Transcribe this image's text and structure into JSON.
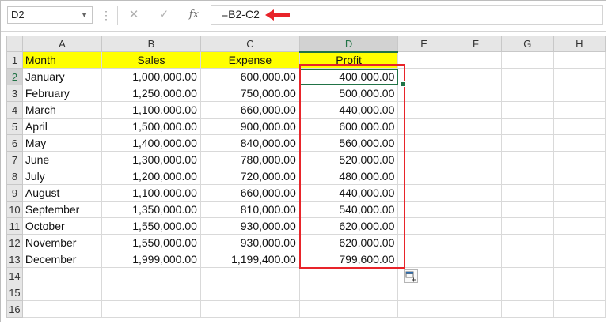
{
  "formula_bar": {
    "name_box": "D2",
    "name_box_arrow": "▼",
    "dots": "⋮",
    "cancel_icon": "✕",
    "enter_icon": "✓",
    "fx_label": "fx",
    "formula": "=B2-C2",
    "arrow_color": "#e8242a"
  },
  "columns": [
    "A",
    "B",
    "C",
    "D",
    "E",
    "F",
    "G",
    "H"
  ],
  "selected_column": "D",
  "selected_cell": "D2",
  "highlight_color": "#e8242a",
  "header_fill_color": "#ffff00",
  "rows": [
    {
      "num": "1",
      "cells": [
        "Month",
        "Sales",
        "Expense",
        "Profit",
        "",
        "",
        "",
        ""
      ]
    },
    {
      "num": "2",
      "cells": [
        "January",
        "1,000,000.00",
        "600,000.00",
        "400,000.00",
        "",
        "",
        "",
        ""
      ]
    },
    {
      "num": "3",
      "cells": [
        "February",
        "1,250,000.00",
        "750,000.00",
        "500,000.00",
        "",
        "",
        "",
        ""
      ]
    },
    {
      "num": "4",
      "cells": [
        "March",
        "1,100,000.00",
        "660,000.00",
        "440,000.00",
        "",
        "",
        "",
        ""
      ]
    },
    {
      "num": "5",
      "cells": [
        "April",
        "1,500,000.00",
        "900,000.00",
        "600,000.00",
        "",
        "",
        "",
        ""
      ]
    },
    {
      "num": "6",
      "cells": [
        "May",
        "1,400,000.00",
        "840,000.00",
        "560,000.00",
        "",
        "",
        "",
        ""
      ]
    },
    {
      "num": "7",
      "cells": [
        "June",
        "1,300,000.00",
        "780,000.00",
        "520,000.00",
        "",
        "",
        "",
        ""
      ]
    },
    {
      "num": "8",
      "cells": [
        "July",
        "1,200,000.00",
        "720,000.00",
        "480,000.00",
        "",
        "",
        "",
        ""
      ]
    },
    {
      "num": "9",
      "cells": [
        "August",
        "1,100,000.00",
        "660,000.00",
        "440,000.00",
        "",
        "",
        "",
        ""
      ]
    },
    {
      "num": "10",
      "cells": [
        "September",
        "1,350,000.00",
        "810,000.00",
        "540,000.00",
        "",
        "",
        "",
        ""
      ]
    },
    {
      "num": "11",
      "cells": [
        "October",
        "1,550,000.00",
        "930,000.00",
        "620,000.00",
        "",
        "",
        "",
        ""
      ]
    },
    {
      "num": "12",
      "cells": [
        "November",
        "1,550,000.00",
        "930,000.00",
        "620,000.00",
        "",
        "",
        "",
        ""
      ]
    },
    {
      "num": "13",
      "cells": [
        "December",
        "1,999,000.00",
        "1,199,400.00",
        "799,600.00",
        "",
        "",
        "",
        ""
      ]
    },
    {
      "num": "14",
      "cells": [
        "",
        "",
        "",
        "",
        "",
        "",
        "",
        ""
      ]
    },
    {
      "num": "15",
      "cells": [
        "",
        "",
        "",
        "",
        "",
        "",
        "",
        ""
      ]
    },
    {
      "num": "16",
      "cells": [
        "",
        "",
        "",
        "",
        "",
        "",
        "",
        ""
      ]
    }
  ]
}
